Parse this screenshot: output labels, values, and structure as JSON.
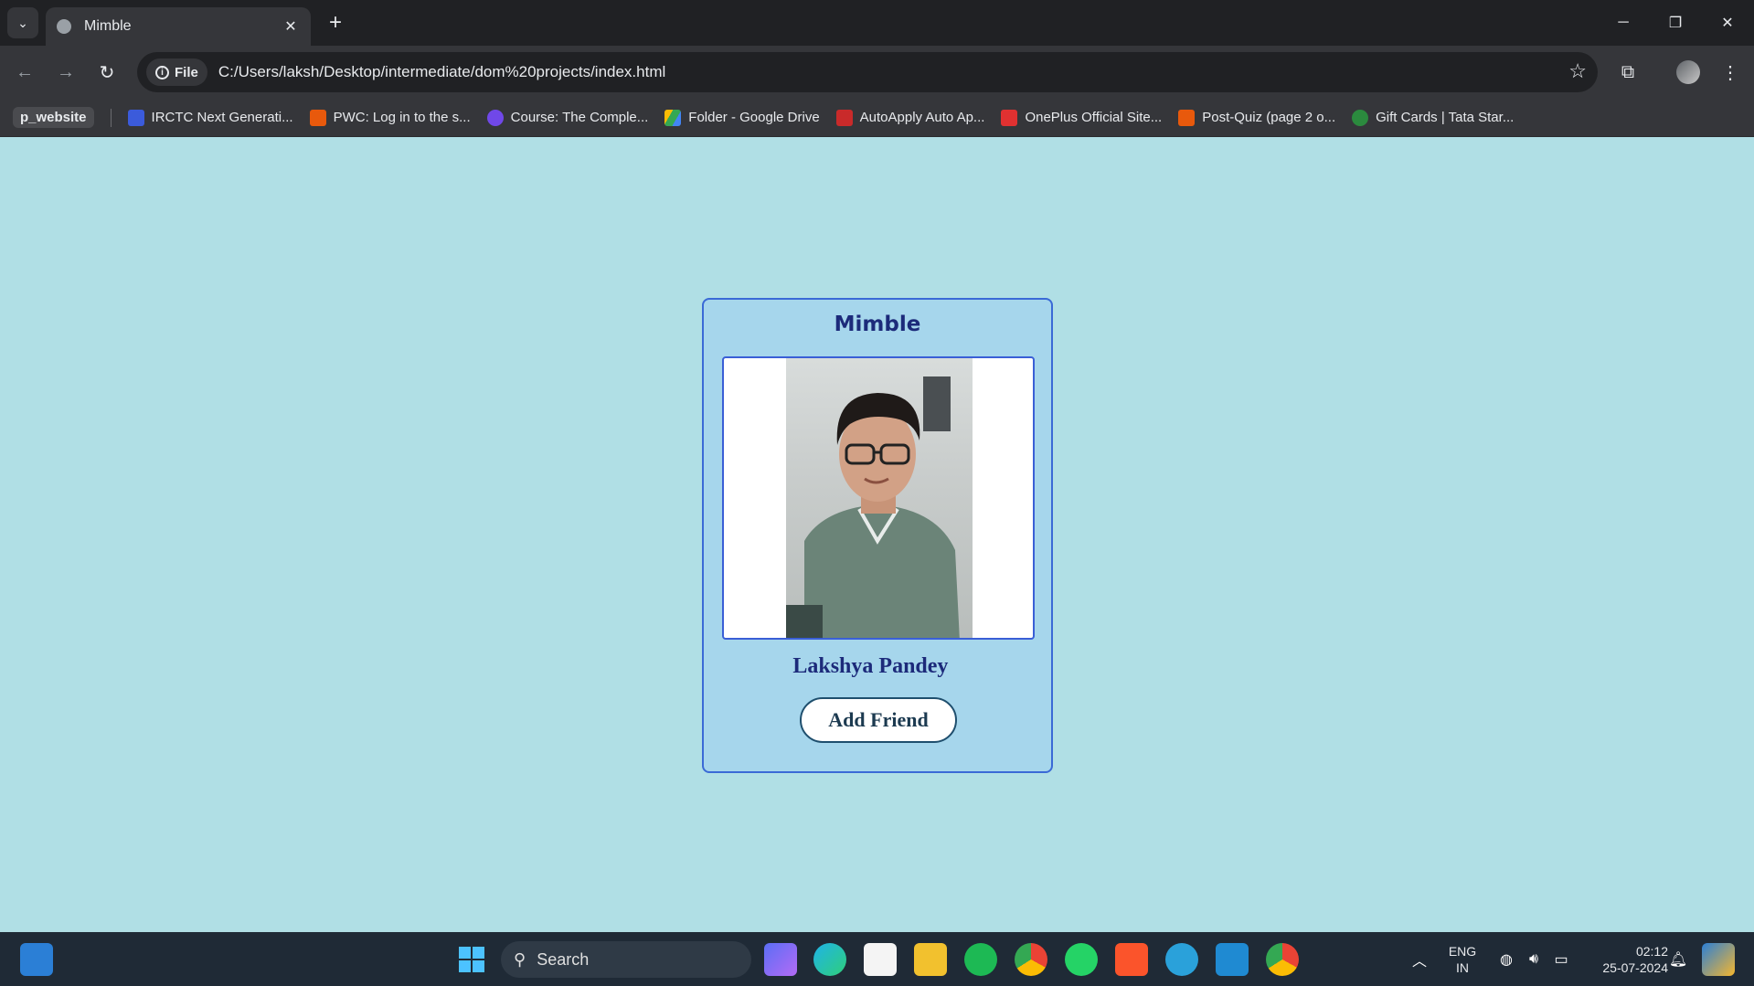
{
  "browser": {
    "tab_title": "Mimble",
    "tab_close": "✕",
    "new_tab": "+",
    "file_chip": "File",
    "url": "C:/Users/laksh/Desktop/intermediate/dom%20projects/index.html",
    "bookmarks": [
      {
        "label": "p_website",
        "color": "#4a4b4f"
      },
      {
        "label": "IRCTC Next Generati...",
        "color": "#3b5bdb"
      },
      {
        "label": "PWC: Log in to the s...",
        "color": "#e8590c"
      },
      {
        "label": "Course: The Comple...",
        "color": "#7048e8"
      },
      {
        "label": "Folder - Google Drive",
        "color": "#2f9e44"
      },
      {
        "label": "AutoApply Auto Ap...",
        "color": "#c92a2a"
      },
      {
        "label": "OnePlus Official Site...",
        "color": "#e03131"
      },
      {
        "label": "Post-Quiz (page 2 o...",
        "color": "#e8590c"
      },
      {
        "label": "Gift Cards | Tata Star...",
        "color": "#2b8a3e"
      }
    ]
  },
  "card": {
    "title": "Mimble",
    "name": "Lakshya Pandey",
    "button_label": "Add Friend"
  },
  "taskbar": {
    "search_label": "Search",
    "lang_top": "ENG",
    "lang_bottom": "IN",
    "time": "02:12",
    "date": "25-07-2024"
  },
  "colors": {
    "page_bg": "#b0dfe5",
    "card_bg": "#a6d6ec",
    "card_border": "#3a6ad6",
    "title_color": "#1c2a7a"
  }
}
